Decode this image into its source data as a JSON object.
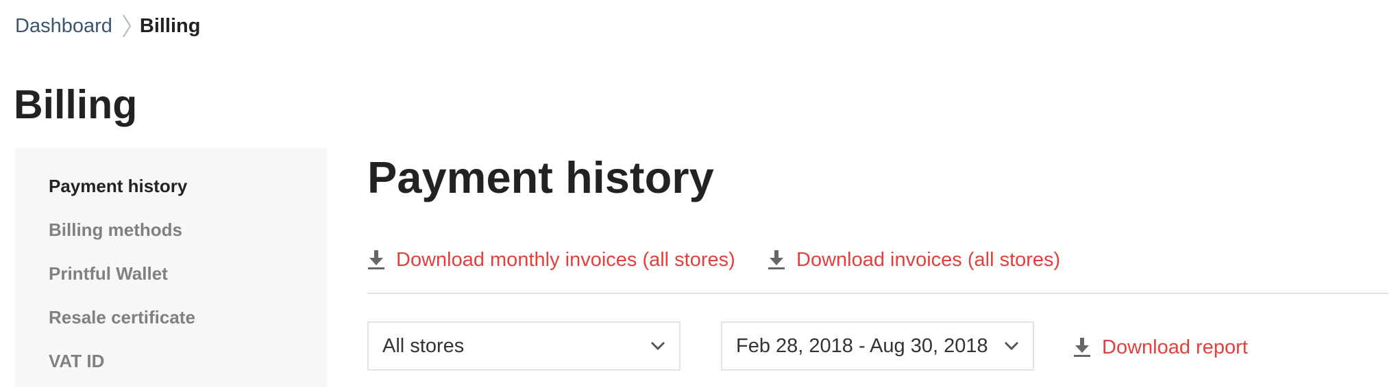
{
  "breadcrumb": {
    "items": [
      {
        "label": "Dashboard"
      },
      {
        "label": "Billing"
      }
    ],
    "separator_icon": "chevron-right-icon"
  },
  "page": {
    "title": "Billing"
  },
  "sidebar": {
    "items": [
      {
        "label": "Payment history",
        "active": true
      },
      {
        "label": "Billing methods",
        "active": false
      },
      {
        "label": "Printful Wallet",
        "active": false
      },
      {
        "label": "Resale certificate",
        "active": false
      },
      {
        "label": "VAT ID",
        "active": false
      }
    ]
  },
  "main": {
    "title": "Payment history",
    "download_links": [
      {
        "label": "Download monthly invoices (all stores)",
        "icon": "download-icon"
      },
      {
        "label": "Download invoices (all stores)",
        "icon": "download-icon"
      }
    ],
    "filters": {
      "store_select": {
        "value": "All stores",
        "icon": "chevron-down-icon"
      },
      "date_range": {
        "value": "Feb 28, 2018 - Aug 30, 2018",
        "icon": "chevron-down-icon"
      }
    },
    "download_report": {
      "label": "Download report",
      "icon": "download-icon"
    }
  },
  "colors": {
    "link_accent": "#e1403d",
    "breadcrumb_link": "#3b5570",
    "text_primary": "#222222",
    "text_muted": "#808080",
    "sidebar_bg": "#f7f7f7",
    "border": "#e3e3e3"
  }
}
